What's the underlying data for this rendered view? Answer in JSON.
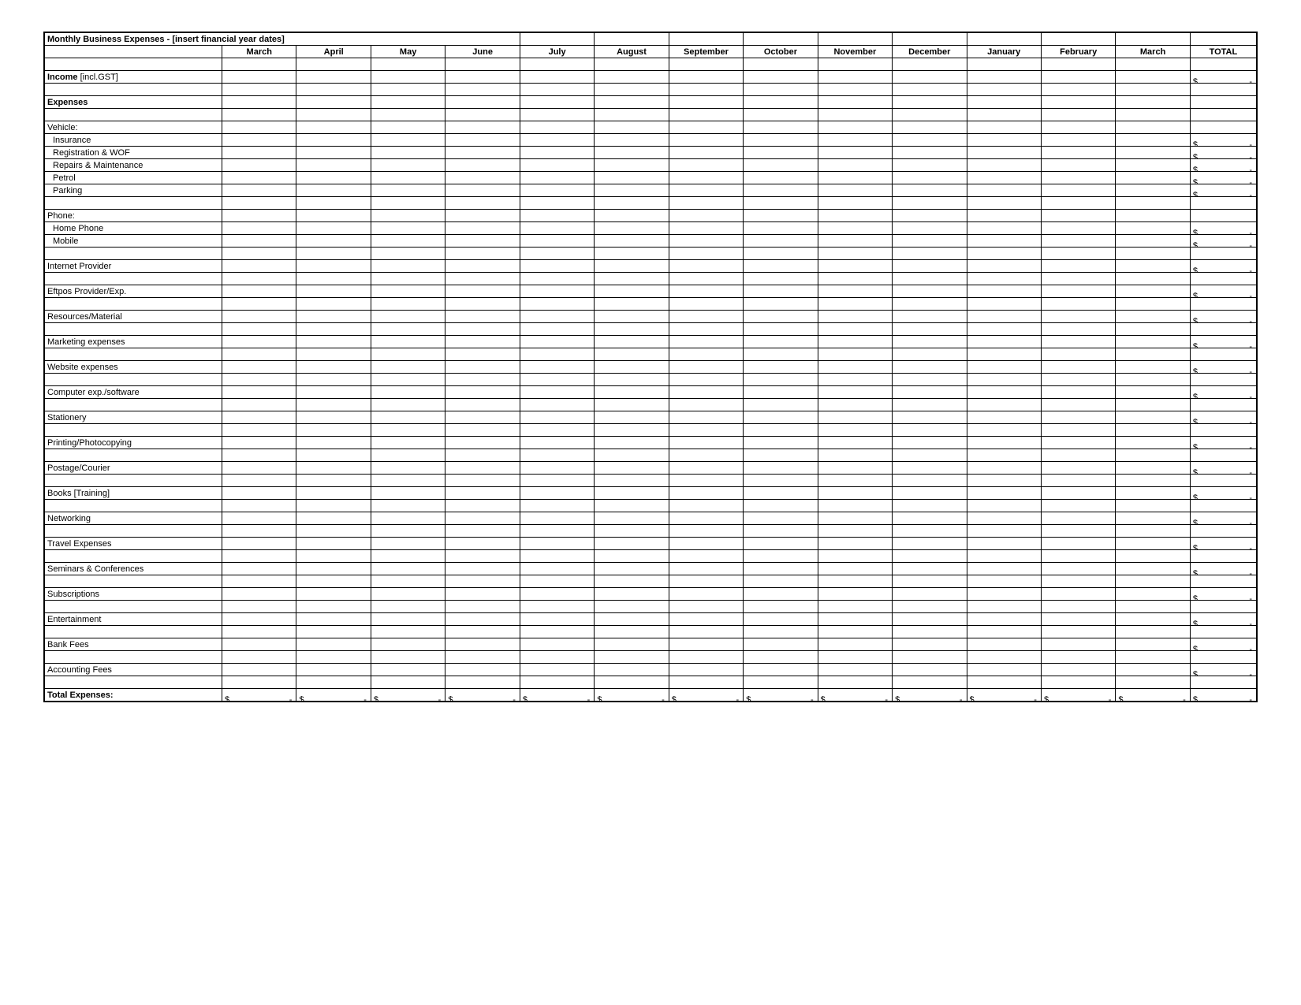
{
  "title": "Monthly Business Expenses - [insert financial year dates]",
  "months": [
    "March",
    "April",
    "May",
    "June",
    "July",
    "August",
    "September",
    "October",
    "November",
    "December",
    "January",
    "February",
    "March"
  ],
  "total_header": "TOTAL",
  "currency_symbol": "$",
  "empty_dash": "-",
  "rows": [
    {
      "type": "blank"
    },
    {
      "type": "line",
      "label": "Income [incl.GST]",
      "bold": false,
      "indent": false,
      "has_total": true,
      "bold_first_word": true
    },
    {
      "type": "blank"
    },
    {
      "type": "line",
      "label": "Expenses",
      "bold": true,
      "indent": false,
      "has_total": false
    },
    {
      "type": "blank"
    },
    {
      "type": "line",
      "label": "Vehicle:",
      "bold": false,
      "indent": false,
      "has_total": false
    },
    {
      "type": "line",
      "label": "Insurance",
      "bold": false,
      "indent": true,
      "has_total": true
    },
    {
      "type": "line",
      "label": "Registration & WOF",
      "bold": false,
      "indent": true,
      "has_total": true
    },
    {
      "type": "line",
      "label": "Repairs & Maintenance",
      "bold": false,
      "indent": true,
      "has_total": true
    },
    {
      "type": "line",
      "label": "Petrol",
      "bold": false,
      "indent": true,
      "has_total": true
    },
    {
      "type": "line",
      "label": "Parking",
      "bold": false,
      "indent": true,
      "has_total": true
    },
    {
      "type": "blank"
    },
    {
      "type": "line",
      "label": "Phone:",
      "bold": false,
      "indent": false,
      "has_total": false
    },
    {
      "type": "line",
      "label": "Home Phone",
      "bold": false,
      "indent": true,
      "has_total": true
    },
    {
      "type": "line",
      "label": "Mobile",
      "bold": false,
      "indent": true,
      "has_total": true
    },
    {
      "type": "blank"
    },
    {
      "type": "line",
      "label": "Internet Provider",
      "bold": false,
      "indent": false,
      "has_total": true
    },
    {
      "type": "blank"
    },
    {
      "type": "line",
      "label": "Eftpos Provider/Exp.",
      "bold": false,
      "indent": false,
      "has_total": true
    },
    {
      "type": "blank"
    },
    {
      "type": "line",
      "label": "Resources/Material",
      "bold": false,
      "indent": false,
      "has_total": true
    },
    {
      "type": "blank"
    },
    {
      "type": "line",
      "label": "Marketing expenses",
      "bold": false,
      "indent": false,
      "has_total": true
    },
    {
      "type": "blank"
    },
    {
      "type": "line",
      "label": "Website expenses",
      "bold": false,
      "indent": false,
      "has_total": true
    },
    {
      "type": "blank"
    },
    {
      "type": "line",
      "label": "Computer exp./software",
      "bold": false,
      "indent": false,
      "has_total": true
    },
    {
      "type": "blank"
    },
    {
      "type": "line",
      "label": "Stationery",
      "bold": false,
      "indent": false,
      "has_total": true
    },
    {
      "type": "blank"
    },
    {
      "type": "line",
      "label": "Printing/Photocopying",
      "bold": false,
      "indent": false,
      "has_total": true
    },
    {
      "type": "blank"
    },
    {
      "type": "line",
      "label": "Postage/Courier",
      "bold": false,
      "indent": false,
      "has_total": true
    },
    {
      "type": "blank"
    },
    {
      "type": "line",
      "label": "Books [Training]",
      "bold": false,
      "indent": false,
      "has_total": true
    },
    {
      "type": "blank"
    },
    {
      "type": "line",
      "label": "Networking",
      "bold": false,
      "indent": false,
      "has_total": true
    },
    {
      "type": "blank"
    },
    {
      "type": "line",
      "label": "Travel Expenses",
      "bold": false,
      "indent": false,
      "has_total": true
    },
    {
      "type": "blank"
    },
    {
      "type": "line",
      "label": "Seminars & Conferences",
      "bold": false,
      "indent": false,
      "has_total": true
    },
    {
      "type": "blank"
    },
    {
      "type": "line",
      "label": "Subscriptions",
      "bold": false,
      "indent": false,
      "has_total": true
    },
    {
      "type": "blank"
    },
    {
      "type": "line",
      "label": "Entertainment",
      "bold": false,
      "indent": false,
      "has_total": true
    },
    {
      "type": "blank"
    },
    {
      "type": "line",
      "label": "Bank Fees",
      "bold": false,
      "indent": false,
      "has_total": true
    },
    {
      "type": "blank"
    },
    {
      "type": "line",
      "label": "Accounting Fees",
      "bold": false,
      "indent": false,
      "has_total": true
    },
    {
      "type": "blank"
    },
    {
      "type": "totals",
      "label": "Total Expenses:",
      "bold": true
    }
  ]
}
